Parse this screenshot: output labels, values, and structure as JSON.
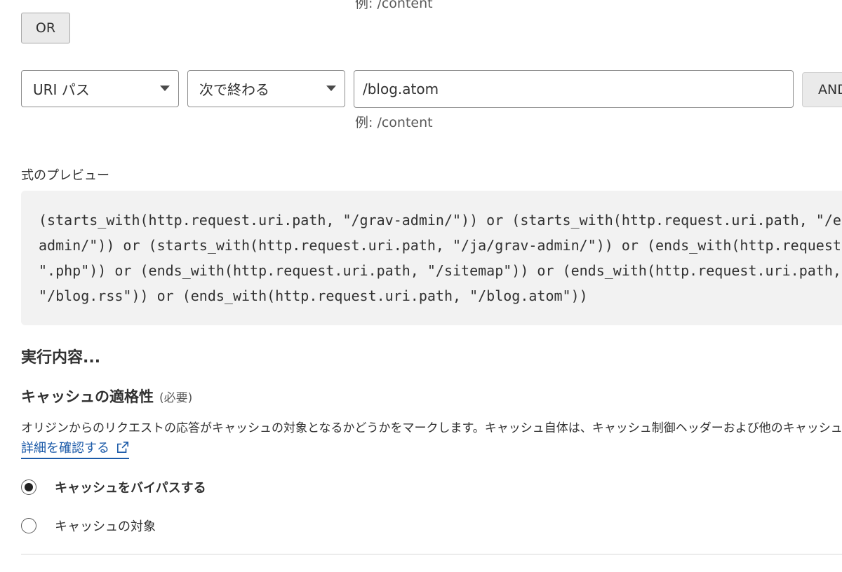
{
  "top_hint": "例: /content",
  "or_button_label": "OR",
  "filter_row": {
    "field_select": "URI パス",
    "operator_select": "次で終わる",
    "value_input": "/blog.atom",
    "and_button_label": "AND",
    "value_hint": "例: /content"
  },
  "expression_preview": {
    "label": "式のプレビュー",
    "lines": [
      "(starts_with(http.request.uri.path, \"/grav-admin/\")) or (starts_with(http.request.uri.path, \"/en/grav-",
      "admin/\")) or (starts_with(http.request.uri.path, \"/ja/grav-admin/\")) or (ends_with(http.request.uri.path,",
      "\".php\")) or (ends_with(http.request.uri.path, \"/sitemap\")) or (ends_with(http.request.uri.path,",
      "\"/blog.rss\")) or (ends_with(http.request.uri.path, \"/blog.atom\"))"
    ]
  },
  "action_section": {
    "title": "実行内容...",
    "cache_eligibility": {
      "title": "キャッシュの適格性",
      "required_label": "(必要)",
      "description": "オリジンからのリクエストの応答がキャッシュの対象となるかどうかをマークします。キャッシュ自体は、キャッシュ制御ヘッダーおよび他のキャッシュ構成に",
      "learn_more_label": "詳細を確認する",
      "options": [
        {
          "label": "キャッシュをバイパスする",
          "selected": true
        },
        {
          "label": "キャッシュの対象",
          "selected": false
        }
      ]
    }
  },
  "colors": {
    "link": "#1b5aa8",
    "preview_background": "#f2f2f2",
    "button_background": "#eaeaea"
  }
}
